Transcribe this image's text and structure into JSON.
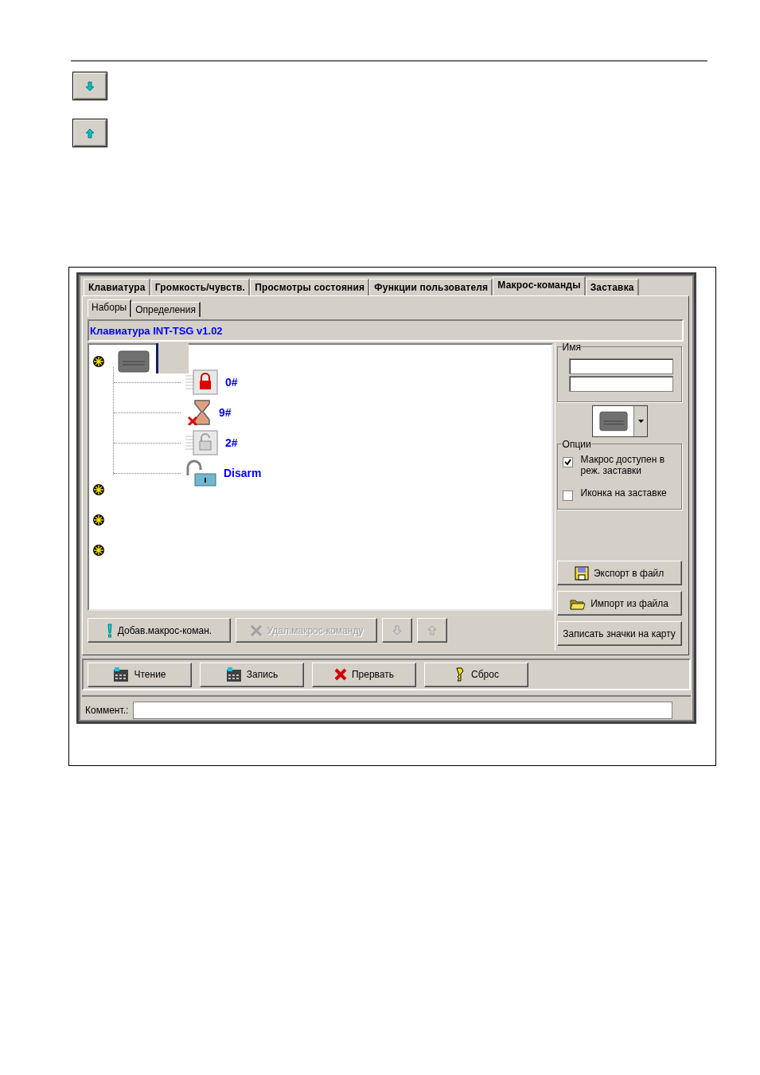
{
  "page_buttons": [
    {
      "kind": "down"
    },
    {
      "kind": "up"
    }
  ],
  "tabs": [
    {
      "label": "Клавиатура",
      "selected": false
    },
    {
      "label": "Громкость/чувств.",
      "selected": false
    },
    {
      "label": "Просмотры состояния",
      "selected": false
    },
    {
      "label": "Функции пользователя",
      "selected": false
    },
    {
      "label": "Макрос-команды",
      "selected": true
    },
    {
      "label": "Заставка",
      "selected": false
    }
  ],
  "subtabs": [
    {
      "label": "Наборы",
      "selected": true
    },
    {
      "label": "Определения",
      "selected": false
    }
  ],
  "header": "Клавиатура INT-TSG v1.02",
  "tree": [
    {
      "kind": "keypad",
      "selected": true,
      "children": [
        {
          "label": "0#",
          "kind": "lock"
        },
        {
          "label": "9#",
          "kind": "hourglass"
        },
        {
          "label": "2#",
          "kind": "lock-plate"
        },
        {
          "label": "Disarm",
          "kind": "padlock"
        }
      ]
    },
    {
      "kind": "blank",
      "selected": false
    },
    {
      "kind": "blank",
      "selected": false
    },
    {
      "kind": "blank",
      "selected": false
    }
  ],
  "tree_buttons": [
    {
      "label": "Добав.макрос-коман.",
      "kind": "exclaim",
      "disabled": false
    },
    {
      "label": "Удал.макрос-команду",
      "kind": "cross",
      "disabled": true
    },
    {
      "kind": "down",
      "disabled": true
    },
    {
      "kind": "up",
      "disabled": true
    }
  ],
  "name_group": {
    "legend": "Имя"
  },
  "options": {
    "legend": "Опции",
    "items": [
      {
        "label": "Макрос доступен в реж. заставки",
        "checked": true
      },
      {
        "label": "Иконка на заставке",
        "checked": false
      }
    ]
  },
  "side_buttons": [
    {
      "label": "Экспорт в  файл",
      "kind": "floppy"
    },
    {
      "label": "Импорт из файла",
      "kind": "folder"
    },
    {
      "label": "Записать значки на карту",
      "kind": "text"
    }
  ],
  "bottom_buttons": [
    {
      "label": "Чтение",
      "kind": "read"
    },
    {
      "label": "Запись",
      "kind": "write"
    },
    {
      "label": "Прервать",
      "kind": "stop"
    },
    {
      "label": "Сброс",
      "kind": "reset"
    }
  ],
  "comment": {
    "label": "Коммент.:"
  }
}
